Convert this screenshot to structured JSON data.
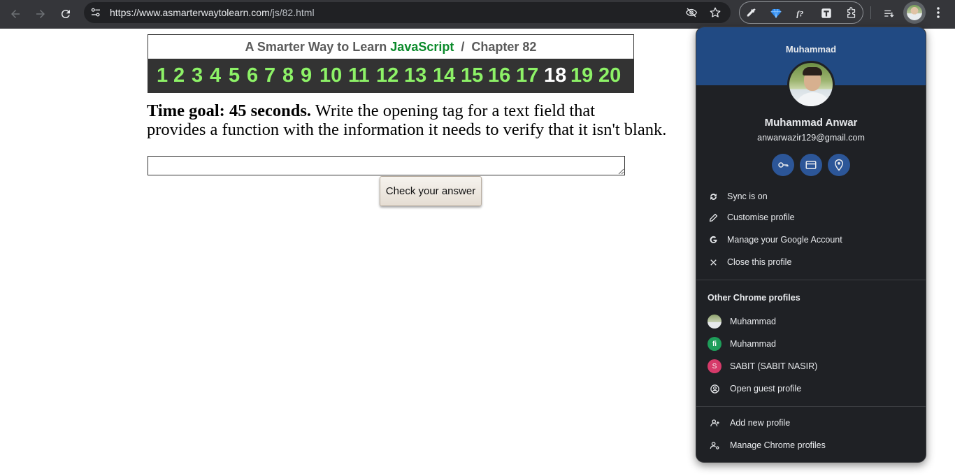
{
  "browser": {
    "url_host": "https://www.asmarterwaytolearn.com",
    "url_path": "/js/82.html",
    "colors": {
      "toolbar": "#35363a",
      "omnibox": "#202124"
    },
    "icons": [
      "back-arrow-icon",
      "forward-arrow-icon",
      "reload-icon",
      "site-info-icon",
      "eye-off-icon",
      "bookmark-star-icon",
      "color-picker-icon",
      "gem-icon",
      "font-icon",
      "text-t-icon",
      "extensions-puzzle-icon",
      "reading-list-icon",
      "profile-avatar",
      "kebab-menu-icon"
    ]
  },
  "page": {
    "header": {
      "title_prefix": "A Smarter Way to Learn",
      "title_brand": "JavaScript",
      "title_separator": "/",
      "title_chapter": "Chapter 82",
      "brand_color": "#0a8a2a"
    },
    "chapter_nav": {
      "items": [
        "1",
        "2",
        "3",
        "4",
        "5",
        "6",
        "7",
        "8",
        "9",
        "10",
        "11",
        "12",
        "13",
        "14",
        "15",
        "16",
        "17",
        "18",
        "19",
        "20"
      ],
      "current": "18",
      "link_color": "#8df267",
      "current_color": "#ffffff"
    },
    "question": {
      "goal": "Time goal: 45 seconds.",
      "line1": "Write the opening tag for a text field that",
      "line2": "provides a function with the information it needs to verify that it isn't blank."
    },
    "answer": {
      "value": ""
    },
    "check_button": "Check your answer"
  },
  "profile_popup": {
    "banner_name": "Muhammad",
    "full_name": "Muhammad Anwar",
    "email": "anwarwazir129@gmail.com",
    "quick_actions": [
      "key-icon",
      "credit-card-icon",
      "location-pin-icon"
    ],
    "menu": [
      {
        "label": "Sync is on",
        "icon": "sync-icon"
      },
      {
        "label": "Customise profile",
        "icon": "pencil-icon"
      },
      {
        "label": "Manage your Google Account",
        "icon": "google-g-icon"
      },
      {
        "label": "Close this profile",
        "icon": "close-icon"
      }
    ],
    "other_title": "Other Chrome profiles",
    "other_profiles": [
      {
        "label": "Muhammad",
        "avatar": "photo-avatar"
      },
      {
        "label": "Muhammad",
        "avatar": "fi-avatar",
        "color": "#1e9e5a"
      },
      {
        "label": "SABIT (SABIT NASIR)",
        "avatar": "S",
        "color": "#d63a6a"
      },
      {
        "label": "Open guest profile",
        "icon": "guest-icon"
      }
    ],
    "bottom": [
      {
        "label": "Add new profile",
        "icon": "add-person-icon"
      },
      {
        "label": "Manage Chrome profiles",
        "icon": "manage-people-icon"
      }
    ],
    "colors": {
      "banner": "#214a83",
      "background": "#1f2125",
      "action_button": "#2c5698"
    }
  }
}
